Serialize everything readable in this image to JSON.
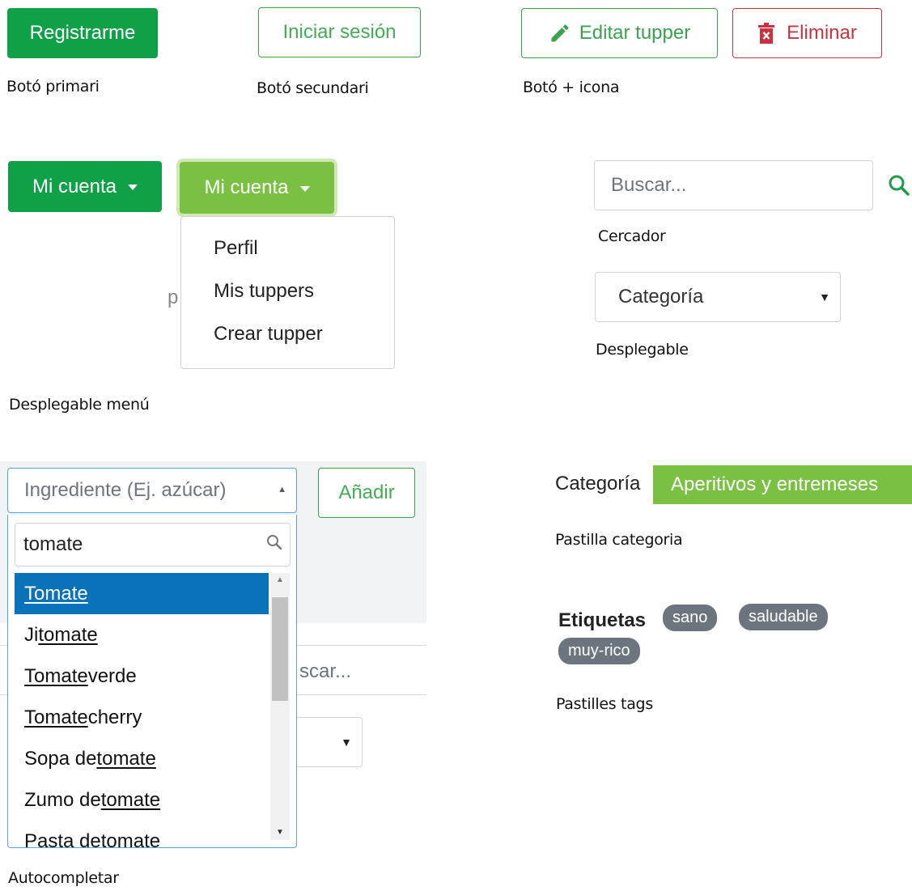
{
  "buttons": {
    "primary": "Registrarme",
    "secondary": "Iniciar sesión",
    "edit": "Editar tupper",
    "delete": "Eliminar"
  },
  "captions": {
    "primary": "Botó primari",
    "secondary": "Botó secundari",
    "icon": "Botó + icona",
    "search": "Cercador",
    "select": "Desplegable",
    "menu": "Desplegable menú",
    "autocomplete": "Autocompletar",
    "category_pill": "Pastilla categoria",
    "tags": "Pastilles tags"
  },
  "account_menu": {
    "label": "Mi cuenta",
    "items": [
      "Perfil",
      "Mis tuppers",
      "Crear tupper"
    ],
    "obscured_text": "p"
  },
  "search": {
    "placeholder": "Buscar..."
  },
  "select": {
    "value": "Categoría",
    "arrow": "▼"
  },
  "autocomplete": {
    "placeholder": "Ingrediente (Ej. azúcar)",
    "add_button": "Añadir",
    "query": "tomate",
    "background_search_fragment": "scar...",
    "results": [
      {
        "pre": "",
        "match": "Tomate",
        "post": ""
      },
      {
        "pre": "Ji",
        "match": "tomate",
        "post": ""
      },
      {
        "pre": "",
        "match": "Tomate",
        "post": " verde"
      },
      {
        "pre": "",
        "match": "Tomate",
        "post": " cherry"
      },
      {
        "pre": "Sopa de ",
        "match": "tomate",
        "post": ""
      },
      {
        "pre": "Zumo de ",
        "match": "tomate",
        "post": ""
      },
      {
        "pre": "Pasta de ",
        "match": "tomate",
        "post": ""
      }
    ]
  },
  "category": {
    "label": "Categoría",
    "value": "Aperitivos y entremeses"
  },
  "tags": {
    "label": "Etiquetas",
    "items": [
      "sano",
      "saludable",
      "muy-rico"
    ]
  },
  "colors": {
    "primary_green": "#0fa048",
    "light_green": "#7ac143",
    "danger": "#c9333e",
    "selected_blue": "#0a72b8",
    "tag_gray": "#6c757d"
  }
}
